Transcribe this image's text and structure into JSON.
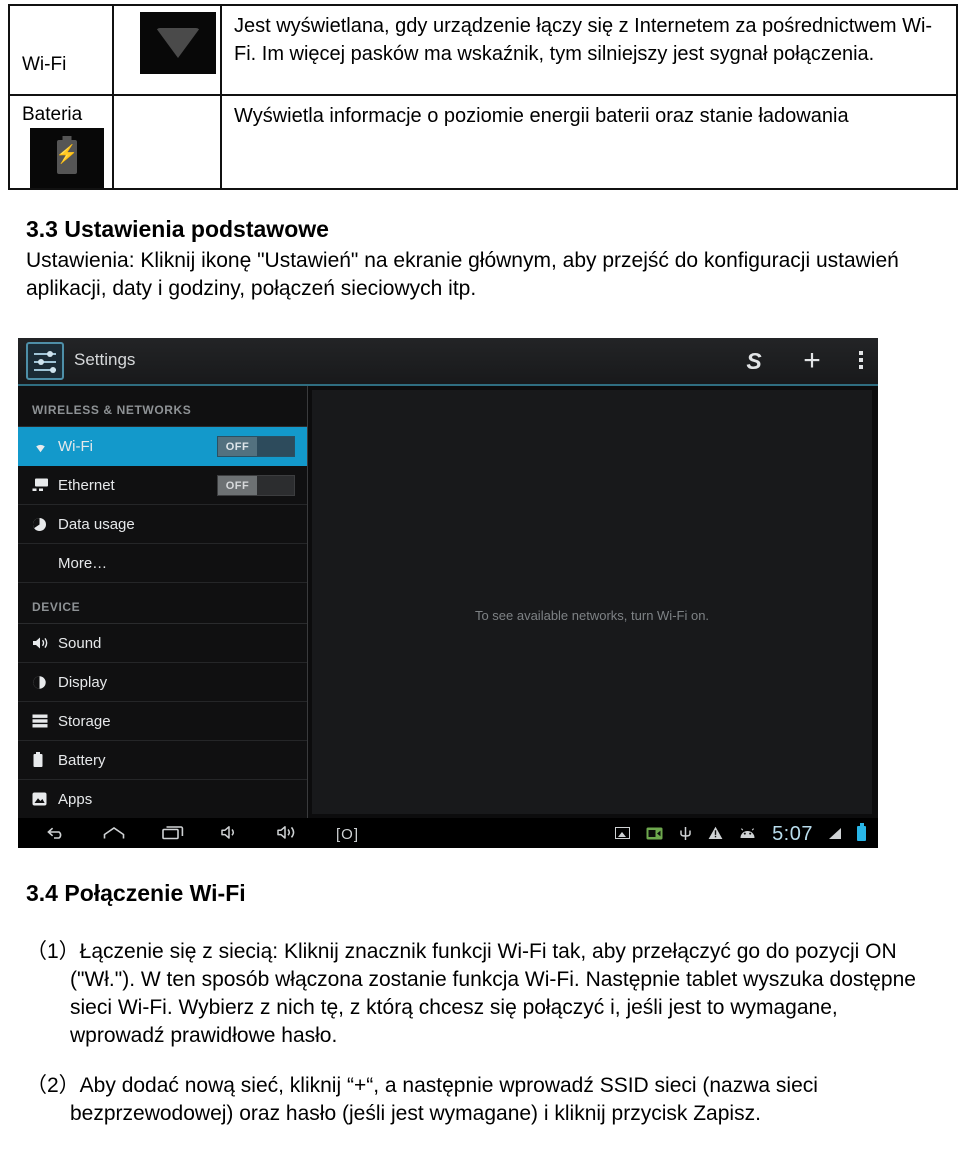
{
  "icon_table": {
    "rows": [
      {
        "label": "Wi-Fi",
        "icon": "wifi-signal-icon",
        "description": "Jest wyświetlana, gdy urządzenie łączy się z Internetem za pośrednictwem Wi-Fi. Im więcej pasków ma wskaźnik, tym silniejszy jest sygnał połączenia."
      },
      {
        "label": "Bateria",
        "icon": "battery-charging-icon",
        "description": "Wyświetla informacje o poziomie energii baterii oraz stanie ładowania"
      }
    ]
  },
  "section_33": {
    "heading": "3.3 Ustawienia podstawowe",
    "paragraph": "Ustawienia: Kliknij ikonę \"Ustawień\" na ekranie głównym, aby przejść do konfiguracji ustawień aplikacji, daty i godziny, połączeń sieciowych itp."
  },
  "settings_screenshot": {
    "topbar": {
      "app_icon": "settings-sliders-icon",
      "title": "Settings",
      "actions": [
        {
          "name": "sync-icon",
          "glyph": "S"
        },
        {
          "name": "add-icon",
          "glyph": "+"
        },
        {
          "name": "overflow-menu-icon",
          "glyph": "⋮"
        }
      ]
    },
    "sidebar": {
      "groups": [
        {
          "title": "WIRELESS & NETWORKS",
          "items": [
            {
              "label": "Wi-Fi",
              "icon": "wifi-icon",
              "glyph": "▲",
              "toggle": "OFF",
              "selected": true
            },
            {
              "label": "Ethernet",
              "icon": "ethernet-icon",
              "glyph": "▬",
              "toggle": "OFF",
              "selected": false
            },
            {
              "label": "Data usage",
              "icon": "data-usage-icon",
              "glyph": "◕",
              "toggle": null,
              "selected": false
            },
            {
              "label": "More…",
              "icon": null,
              "glyph": "",
              "toggle": null,
              "selected": false
            }
          ]
        },
        {
          "title": "DEVICE",
          "items": [
            {
              "label": "Sound",
              "icon": "sound-icon",
              "glyph": "🔊",
              "toggle": null,
              "selected": false
            },
            {
              "label": "Display",
              "icon": "display-icon",
              "glyph": "◑",
              "toggle": null,
              "selected": false
            },
            {
              "label": "Storage",
              "icon": "storage-icon",
              "glyph": "▤",
              "toggle": null,
              "selected": false
            },
            {
              "label": "Battery",
              "icon": "battery-icon",
              "glyph": "▮",
              "toggle": null,
              "selected": false
            },
            {
              "label": "Apps",
              "icon": "apps-icon",
              "glyph": "▨",
              "toggle": null,
              "selected": false
            }
          ]
        }
      ]
    },
    "content": {
      "empty_message": "To see available networks, turn Wi-Fi on."
    },
    "navbar": {
      "left_buttons": [
        {
          "name": "back-button-icon",
          "glyph": "↰"
        },
        {
          "name": "home-button-icon",
          "glyph": "⌂"
        },
        {
          "name": "recents-button-icon",
          "glyph": "❐"
        },
        {
          "name": "volume-down-icon",
          "glyph": "🔈"
        },
        {
          "name": "volume-up-icon",
          "glyph": "🔊"
        },
        {
          "name": "screenshot-icon",
          "glyph": "[O]"
        }
      ],
      "status_icons": [
        {
          "name": "screenshot-saved-icon",
          "glyph": ""
        },
        {
          "name": "sd-card-icon",
          "glyph": "▤"
        },
        {
          "name": "usb-icon",
          "glyph": "Ψ"
        },
        {
          "name": "warning-icon",
          "glyph": "⚠"
        },
        {
          "name": "android-robot-icon",
          "glyph": "🤖"
        }
      ],
      "clock": "5:07",
      "signal_icon": "signal-icon",
      "battery_icon": "battery-status-icon"
    },
    "accent_color": "#1399cb"
  },
  "section_34": {
    "heading": "3.4 Połączenie Wi-Fi",
    "item_1": "（1）Łączenie się z siecią: Kliknij znacznik funkcji Wi-Fi tak, aby przełączyć go do pozycji ON (\"Wł.\"). W ten sposób włączona zostanie funkcja Wi-Fi. Następnie tablet wyszuka dostępne sieci Wi-Fi. Wybierz z nich tę, z którą chcesz się połączyć i, jeśli jest to wymagane, wprowadź prawidłowe hasło.",
    "item_2": "（2）Aby dodać nową sieć, kliknij “+“, a następnie wprowadź SSID sieci (nazwa sieci bezprzewodowej) oraz hasło (jeśli jest wymagane) i kliknij przycisk Zapisz."
  }
}
